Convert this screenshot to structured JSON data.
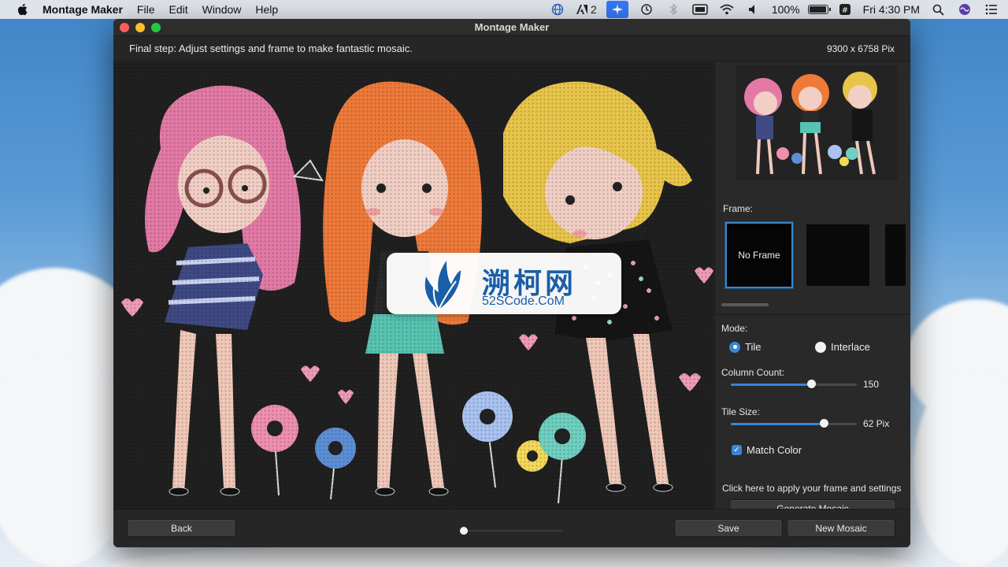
{
  "menubar": {
    "app_name": "Montage Maker",
    "menus": [
      "File",
      "Edit",
      "Window",
      "Help"
    ],
    "adobe_badge": "2",
    "battery_percent": "100%",
    "battery_level": 1.0,
    "clock": "Fri 4:30 PM",
    "status_icons": [
      "globe-icon",
      "adobe-icon",
      "airplane-icon",
      "time-machine-icon",
      "bluetooth-icon",
      "display-icon",
      "wifi-icon",
      "volume-icon",
      "battery-icon",
      "input-icon",
      "search-icon",
      "siri-icon",
      "list-icon"
    ]
  },
  "window": {
    "title": "Montage Maker",
    "instruction": "Final step: Adjust settings and frame to make fantastic mosaic.",
    "dimensions": "9300 x 6758 Pix"
  },
  "side_panel": {
    "frame_label": "Frame:",
    "frames": [
      "No Frame",
      "",
      ""
    ],
    "selected_frame": "No Frame",
    "mode_label": "Mode:",
    "mode_options": [
      "Tile",
      "Interlace"
    ],
    "selected_mode": "Tile",
    "column_count_label": "Column Count:",
    "column_count_value": "150",
    "column_count_fraction": 0.64,
    "tile_size_label": "Tile Size:",
    "tile_size_value": "62 Pix",
    "tile_size_fraction": 0.74,
    "match_color_label": "Match Color",
    "match_color_checked": true,
    "apply_hint": "Click here to apply your frame and settings",
    "generate_button": "Generate Mosaic"
  },
  "footer": {
    "back_button": "Back",
    "save_button": "Save",
    "new_mosaic_button": "New Mosaic",
    "page_position": 0.0
  },
  "watermark": {
    "title": "溯柯网",
    "subtitle": "52SCode.CoM"
  },
  "colors": {
    "accent": "#3a86d6",
    "window_bg": "#262626",
    "watermark_blue": "#1a5ea8"
  }
}
